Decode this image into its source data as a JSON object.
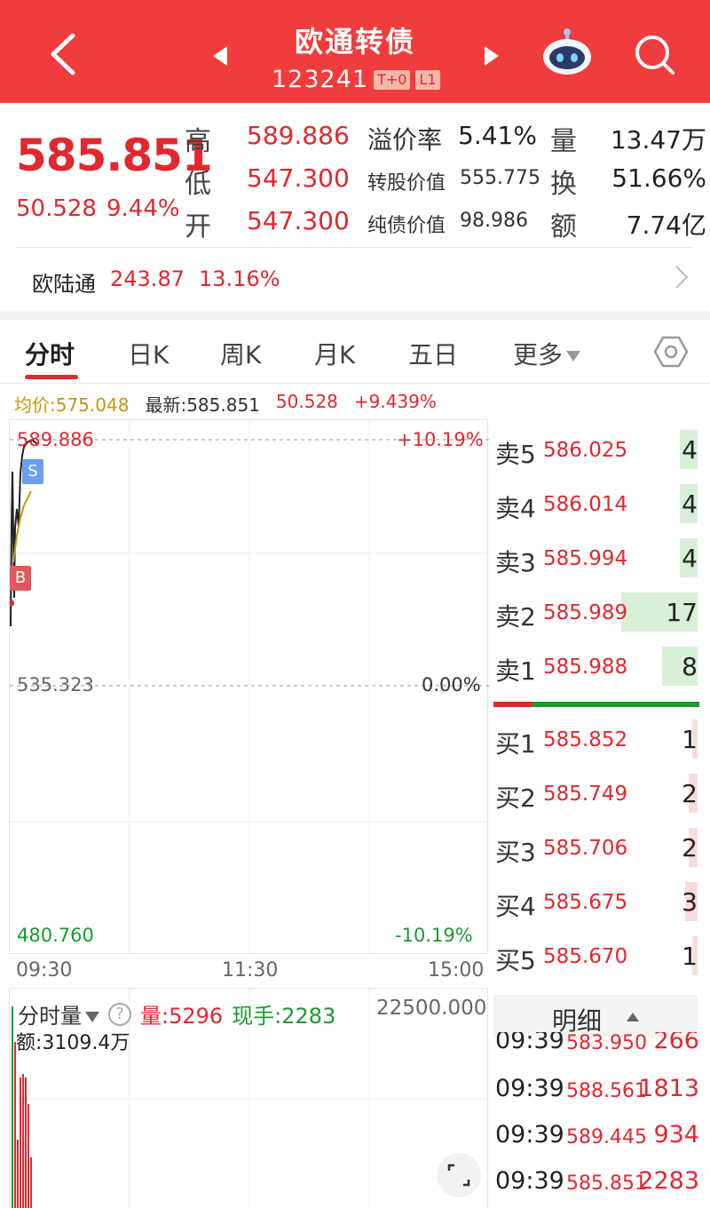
{
  "header": {
    "title": "欧通转债",
    "code": "123241",
    "badges": [
      "T+0",
      "L1"
    ]
  },
  "quote": {
    "price": "585.851",
    "change": "50.528",
    "change_pct": "9.44%",
    "labels": {
      "high": "高",
      "low": "低",
      "open": "开",
      "volume": "量",
      "turnover": "换",
      "amount": "额"
    },
    "high": "589.886",
    "low": "547.300",
    "open": "547.300",
    "premium_label": "溢价率",
    "premium": "5.41%",
    "conv_value_label": "转股价值",
    "conv_value": "555.775",
    "bond_value_label": "纯债价值",
    "bond_value": "98.986",
    "volume": "13.47万",
    "turnover": "51.66%",
    "amount": "7.74亿"
  },
  "stock": {
    "name": "欧陆通",
    "price": "243.87",
    "pct": "13.16%"
  },
  "tabs": {
    "t1": "分时",
    "t2": "日K",
    "t3": "周K",
    "t4": "月K",
    "t5": "五日",
    "t6": "更多"
  },
  "info": {
    "avg": "均价:575.048",
    "latest": "最新:585.851",
    "change": "50.528",
    "pct": "+9.439%"
  },
  "chart": {
    "top_price": "589.886",
    "top_pct": "+10.19%",
    "mid_price": "535.323",
    "mid_pct": "0.00%",
    "bottom_price": "480.760",
    "bottom_pct": "-10.19%",
    "times": [
      "09:30",
      "11:30",
      "15:00"
    ],
    "markers": {
      "sell": "S",
      "buy": "B"
    }
  },
  "order_book": {
    "asks": [
      {
        "label": "卖5",
        "price": "586.025",
        "vol": "4"
      },
      {
        "label": "卖4",
        "price": "586.014",
        "vol": "4"
      },
      {
        "label": "卖3",
        "price": "585.994",
        "vol": "4"
      },
      {
        "label": "卖2",
        "price": "585.989",
        "vol": "17"
      },
      {
        "label": "卖1",
        "price": "585.988",
        "vol": "8"
      }
    ],
    "bids": [
      {
        "label": "买1",
        "price": "585.852",
        "vol": "1"
      },
      {
        "label": "买2",
        "price": "585.749",
        "vol": "2"
      },
      {
        "label": "买3",
        "price": "585.706",
        "vol": "2"
      },
      {
        "label": "买4",
        "price": "585.675",
        "vol": "3"
      },
      {
        "label": "买5",
        "price": "585.670",
        "vol": "1"
      }
    ]
  },
  "volume_panel": {
    "selector": "分时量",
    "vol": "量:5296",
    "current": "现手:2283",
    "max": "22500.000",
    "amount": "额:3109.4万"
  },
  "detail": {
    "title": "明细",
    "rows": [
      {
        "time": "09:39",
        "price": "583.950",
        "vol": "266"
      },
      {
        "time": "09:39",
        "price": "588.561",
        "vol": "1813"
      },
      {
        "time": "09:39",
        "price": "589.445",
        "vol": "934"
      },
      {
        "time": "09:39",
        "price": "585.851",
        "vol": "2283"
      }
    ]
  },
  "colors": {
    "header_bg": "#f03c3c",
    "up": "#e0282e",
    "down": "#1a9b2e",
    "avg_line": "#c8960a"
  }
}
